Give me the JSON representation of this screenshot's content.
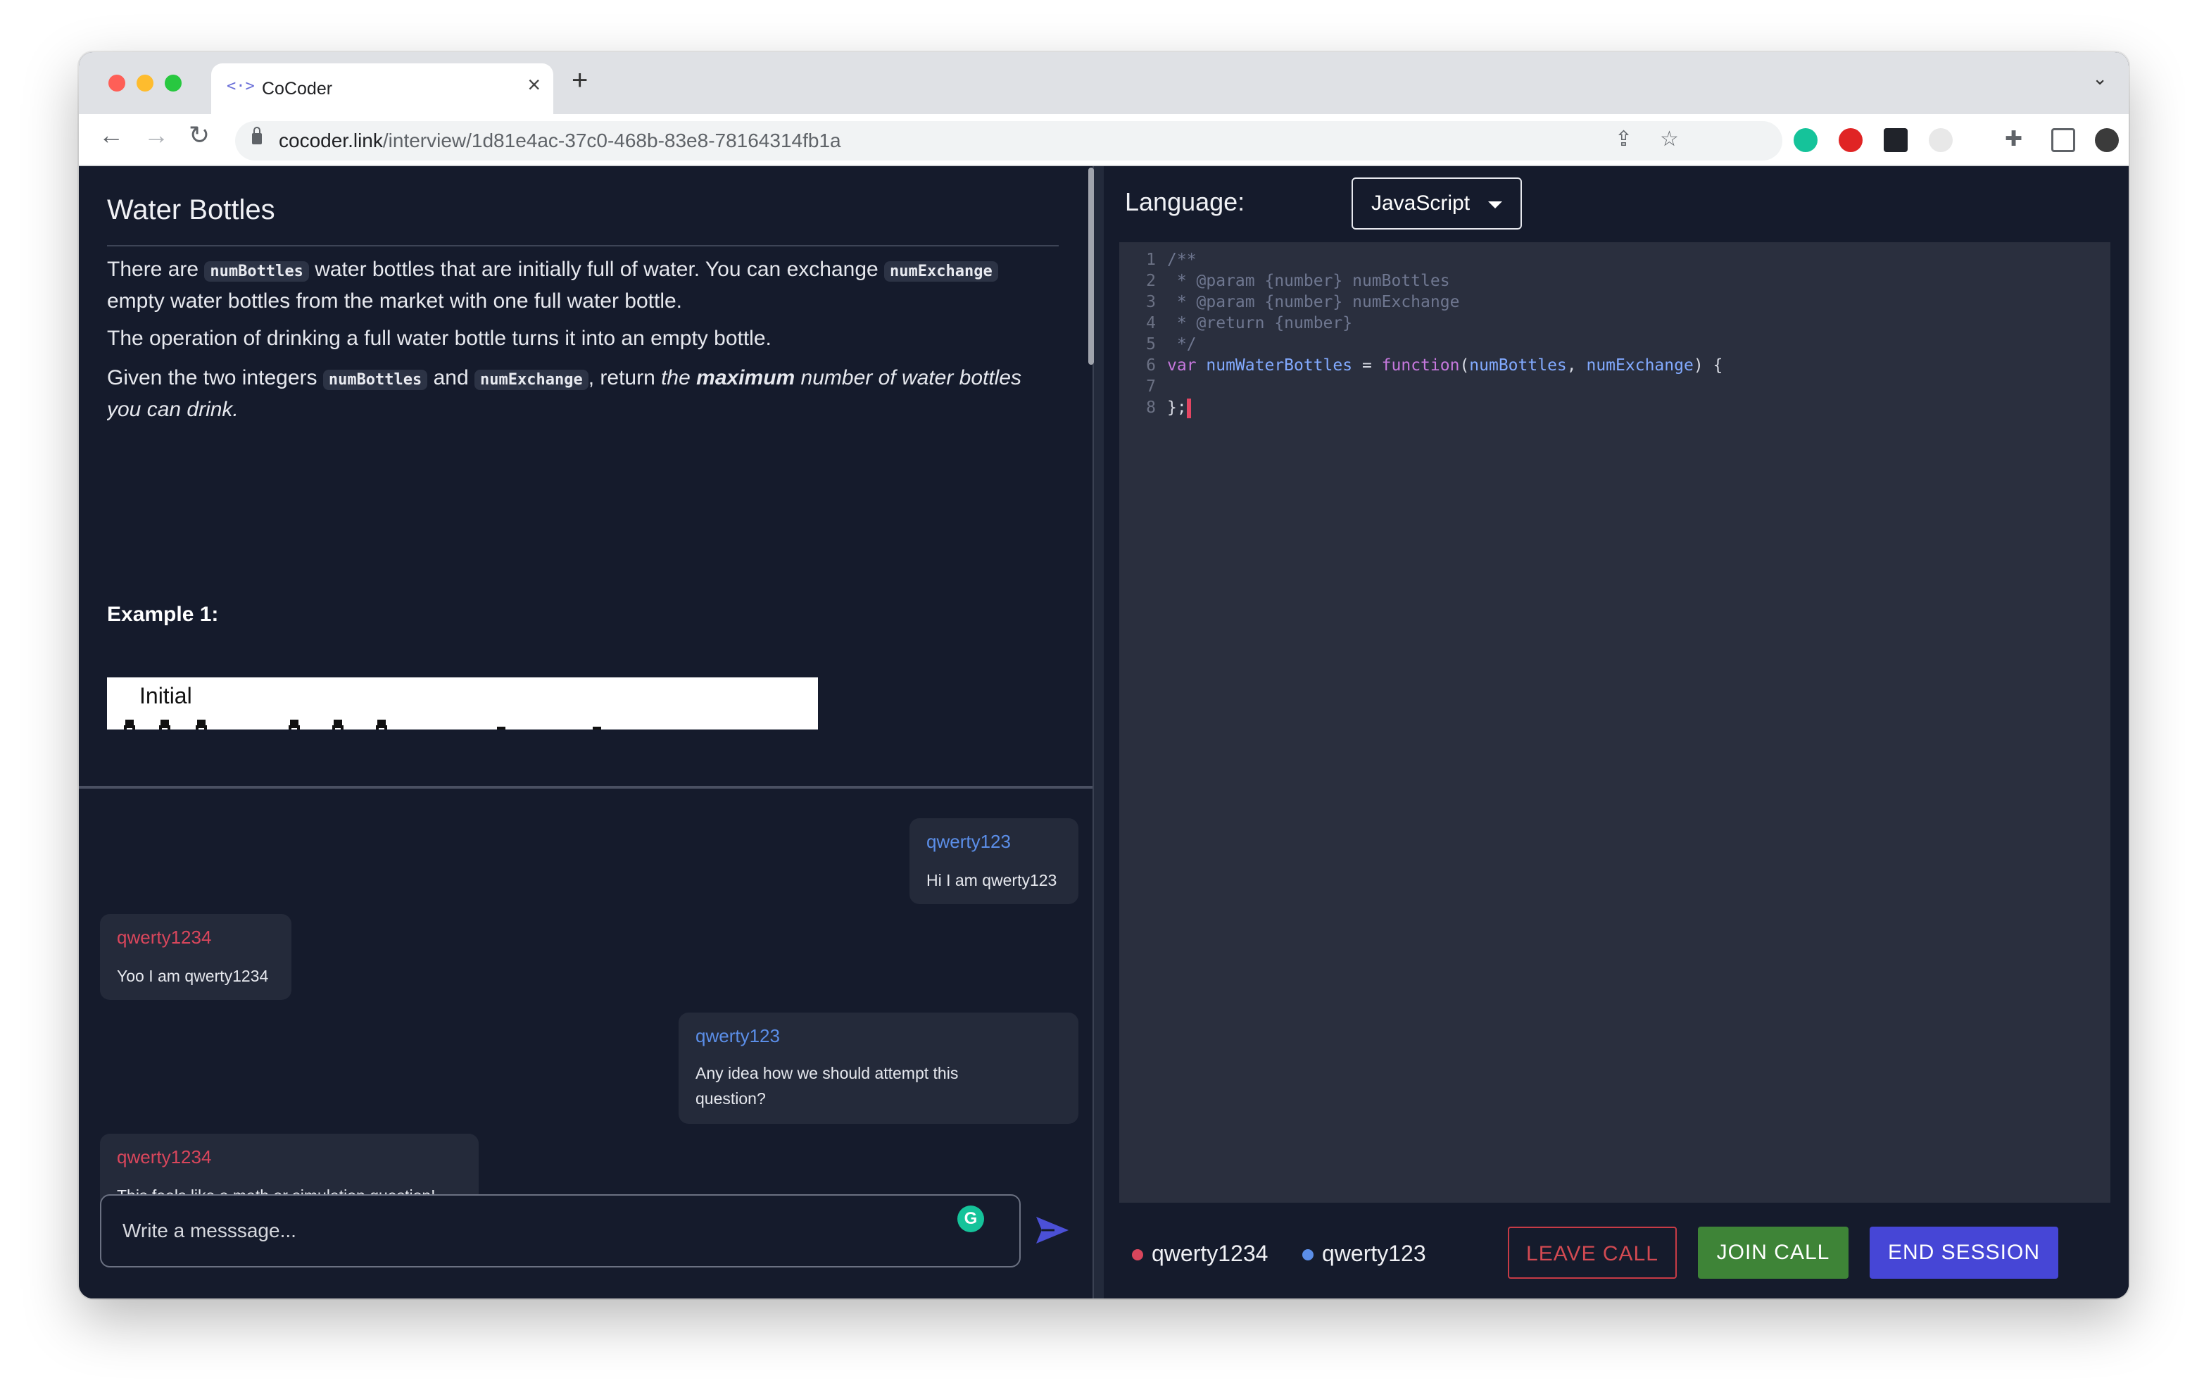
{
  "browser": {
    "tab_title": "CoCoder",
    "tab_favicon": "<·>",
    "url_host": "cocoder.link",
    "url_path": "/interview/1d81e4ac-37c0-468b-83e8-78164314fb1a"
  },
  "problem": {
    "title": "Water Bottles",
    "p1": {
      "code1": "numBottles",
      "text1": " water bottles that are initially full of water. You can exchange ",
      "code2": "numExchange",
      "text2": " empty water bottles from the market with one full water bottle.",
      "prefix": "There are "
    },
    "p2": "The operation of drinking a full water bottle turns it into an empty bottle.",
    "p3": {
      "prefix": "Given the two integers ",
      "code1": "numBottles",
      "and": " and ",
      "code2": "numExchange",
      "mid": ", return ",
      "em1": "the ",
      "strong": "maximum",
      "em2": " number of water bottles you can drink."
    },
    "example_label": "Example 1:",
    "example_image_label": "Initial"
  },
  "chat": {
    "messages": [
      {
        "user": "qwerty123",
        "text": "Hi I am qwerty123",
        "side": "right"
      },
      {
        "user": "qwerty1234",
        "text": "Yoo I am qwerty1234",
        "side": "left"
      },
      {
        "user": "qwerty123",
        "text_line1": "Any idea how we should attempt this",
        "text_line2": "question?",
        "side": "right"
      },
      {
        "user": "qwerty1234",
        "text": "This feels like a math or simulation question!",
        "side": "left"
      }
    ],
    "input_placeholder": "Write a messsage..."
  },
  "editor": {
    "language_label": "Language:",
    "language_value": "JavaScript",
    "lines": {
      "l1": "/**",
      "l2": " * @param {number} numBottles",
      "l3": " * @param {number} numExchange",
      "l4": " * @return {number}",
      "l5": " */",
      "l6_kw": "var ",
      "l6_name": "numWaterBottles",
      "l6_eq": " = ",
      "l6_fn": "function",
      "l6_open": "(",
      "l6_p1": "numBottles",
      "l6_comma": ", ",
      "l6_p2": "numExchange",
      "l6_close": ") {",
      "l7": "",
      "l8": "};"
    },
    "line_numbers": [
      "1",
      "2",
      "3",
      "4",
      "5",
      "6",
      "7",
      "8"
    ]
  },
  "session": {
    "participants": [
      {
        "name": "qwerty1234",
        "color": "#d9465c"
      },
      {
        "name": "qwerty123",
        "color": "#5b8ee8"
      }
    ],
    "leave_label": "LEAVE CALL",
    "join_label": "JOIN CALL",
    "end_label": "END SESSION"
  },
  "colors": {
    "app_bg": "#151b2c",
    "editor_bg": "#2a2f3e",
    "leave": "#c73b46",
    "join": "#3e8437",
    "end": "#4646d6"
  }
}
